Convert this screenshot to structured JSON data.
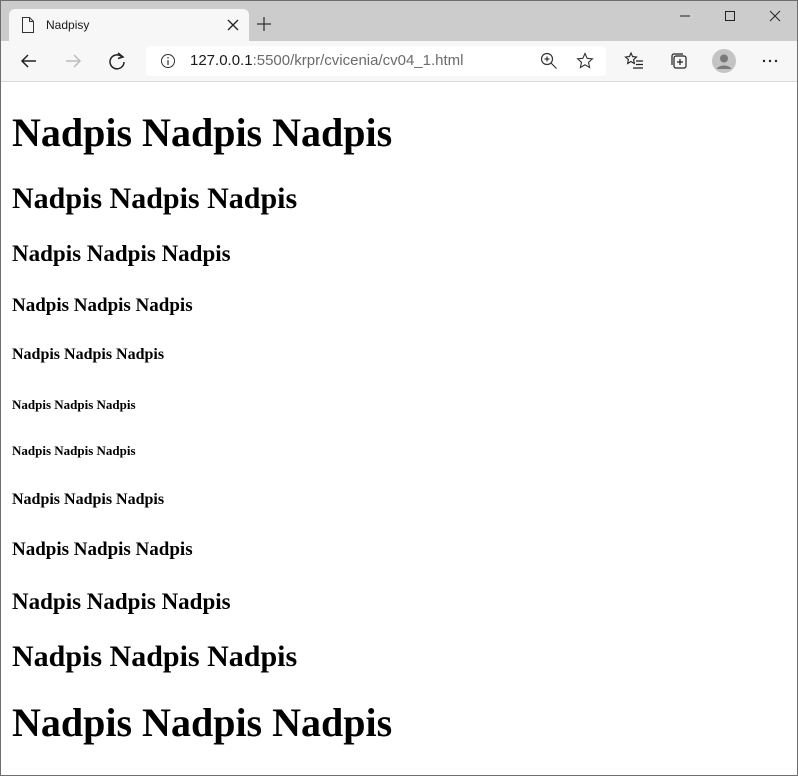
{
  "browser": {
    "tab": {
      "title": "Nadpisy",
      "page_icon": "page-icon",
      "close_icon": "close-icon"
    },
    "new_tab_icon": "plus-icon",
    "window_controls": [
      "minimize-icon",
      "maximize-icon",
      "close-icon"
    ],
    "address": {
      "host": "127.0.0.1",
      "rest": ":5500/krpr/cvicenia/cv04_1.html",
      "info_icon": "info-icon",
      "zoom_icon": "zoom-in-icon",
      "favorite_icon": "star-icon"
    },
    "toolbar_icons": [
      "back-arrow-icon",
      "forward-arrow-icon",
      "refresh-icon",
      "favorites-icon",
      "collections-icon",
      "profile-icon",
      "more-menu-icon"
    ]
  },
  "page": {
    "headings": [
      "Nadpis Nadpis Nadpis",
      "Nadpis Nadpis Nadpis",
      "Nadpis Nadpis Nadpis",
      "Nadpis Nadpis Nadpis",
      "Nadpis Nadpis Nadpis",
      "Nadpis Nadpis Nadpis",
      "Nadpis Nadpis Nadpis",
      "Nadpis Nadpis Nadpis",
      "Nadpis Nadpis Nadpis",
      "Nadpis Nadpis Nadpis",
      "Nadpis Nadpis Nadpis",
      "Nadpis Nadpis Nadpis"
    ]
  }
}
